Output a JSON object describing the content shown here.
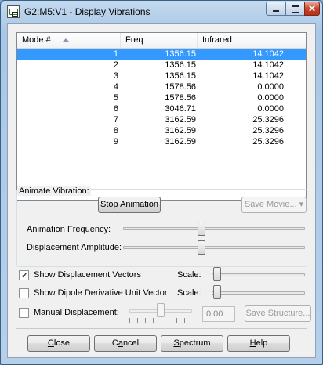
{
  "window": {
    "title": "G2:M5:V1 - Display Vibrations"
  },
  "table": {
    "columns": [
      "Mode #",
      "Freq",
      "Infrared"
    ],
    "rows": [
      {
        "mode": "1",
        "freq": "1356.15",
        "ir": "14.1042"
      },
      {
        "mode": "2",
        "freq": "1356.15",
        "ir": "14.1042"
      },
      {
        "mode": "3",
        "freq": "1356.15",
        "ir": "14.1042"
      },
      {
        "mode": "4",
        "freq": "1578.56",
        "ir": "0.0000"
      },
      {
        "mode": "5",
        "freq": "1578.56",
        "ir": "0.0000"
      },
      {
        "mode": "6",
        "freq": "3046.71",
        "ir": "0.0000"
      },
      {
        "mode": "7",
        "freq": "3162.59",
        "ir": "25.3296"
      },
      {
        "mode": "8",
        "freq": "3162.59",
        "ir": "25.3296"
      },
      {
        "mode": "9",
        "freq": "3162.59",
        "ir": "25.3296"
      }
    ],
    "selected_row": 0
  },
  "animate": {
    "group_label": "Animate Vibration:",
    "stop_prefix": "S",
    "stop_rest": "top Animation",
    "save_movie": "Save Movie...",
    "freq_label": "Animation Frequency:",
    "freq_level": 0.43,
    "amp_label": "Displacement Amplitude:",
    "amp_level": 0.43
  },
  "options": {
    "show_disp_vectors": "Show Displacement Vectors",
    "show_disp_checked": true,
    "scale1_label": "Scale:",
    "scale1_level": 0.02,
    "show_dipole": "Show Dipole Derivative Unit Vector",
    "show_dipole_checked": false,
    "scale2_label": "Scale:",
    "scale2_level": 0.02,
    "manual_label": "Manual Displacement:",
    "manual_checked": false,
    "manual_level": 0.5,
    "manual_value": "0.00",
    "save_structure": "Save Structure..."
  },
  "buttons": {
    "close_u": "C",
    "close_rest": "lose",
    "cancel_pre": "C",
    "cancel_u": "a",
    "cancel_rest": "ncel",
    "spectrum_u": "S",
    "spectrum_rest": "pectrum",
    "help_u": "H",
    "help_rest": "elp"
  }
}
